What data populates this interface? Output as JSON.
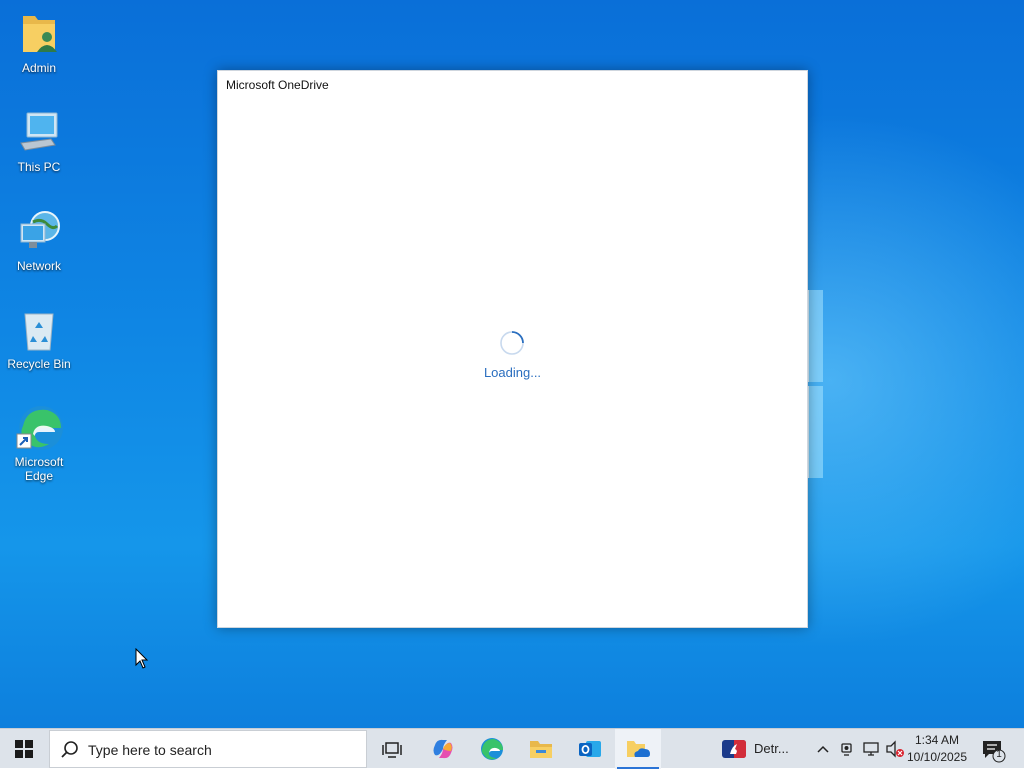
{
  "desktop": {
    "icons": [
      {
        "label": "Admin",
        "icon": "user-folder-icon"
      },
      {
        "label": "This PC",
        "icon": "computer-icon"
      },
      {
        "label": "Network",
        "icon": "network-icon"
      },
      {
        "label": "Recycle Bin",
        "icon": "recycle-bin-icon"
      },
      {
        "label": "Microsoft Edge",
        "icon": "edge-icon"
      }
    ]
  },
  "onedrive": {
    "title": "Microsoft OneDrive",
    "status": "Loading..."
  },
  "taskbar": {
    "search_placeholder": "Type here to search",
    "news_label": "Detr...",
    "time": "1:34 AM",
    "date": "10/10/2025",
    "notification_count": "1"
  },
  "colors": {
    "accent": "#2b74d6",
    "loading_text": "#2a6ebf"
  }
}
